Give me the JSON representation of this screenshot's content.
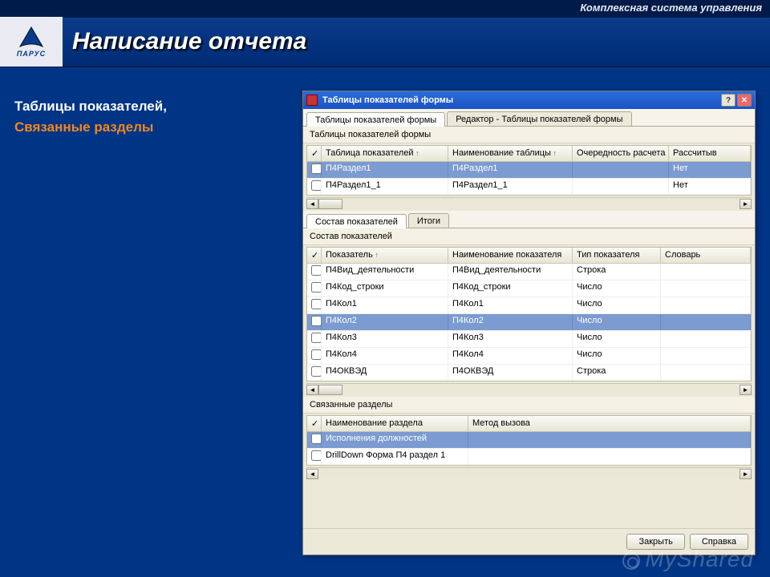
{
  "topbar": {
    "title": "Комплексная система управления"
  },
  "logo": {
    "brand": "ПАРУС"
  },
  "page": {
    "title": "Написание отчета"
  },
  "side": {
    "line1": "Таблицы показателей,",
    "line2": "Связанные разделы"
  },
  "watermark": "MyShared",
  "dialog": {
    "title": "Таблицы показателей формы",
    "tabs_main": [
      "Таблицы показателей формы",
      "Редактор - Таблицы показателей формы"
    ],
    "active_main_tab": 0,
    "section1": {
      "title": "Таблицы показателей формы",
      "headers": [
        "",
        "Таблица показателей",
        "Наименование таблицы",
        "Очередность расчета",
        "Рассчитыв"
      ],
      "rows": [
        {
          "sel": true,
          "name": "П4Раздел1",
          "desc": "П4Раздел1",
          "calc": "",
          "flag": "Нет"
        },
        {
          "sel": false,
          "name": "П4Раздел1_1",
          "desc": "П4Раздел1_1",
          "calc": "",
          "flag": "Нет"
        }
      ]
    },
    "tabs_mid": [
      "Состав показателей",
      "Итоги"
    ],
    "active_mid_tab": 0,
    "section2": {
      "title": "Состав показателей",
      "headers": [
        "",
        "Показатель",
        "Наименование показателя",
        "Тип показателя",
        "Словарь"
      ],
      "rows": [
        {
          "sel": false,
          "name": "П4Вид_деятельности",
          "desc": "П4Вид_деятельности",
          "type": "Строка",
          "dict": ""
        },
        {
          "sel": false,
          "name": "П4Код_строки",
          "desc": "П4Код_строки",
          "type": "Число",
          "dict": ""
        },
        {
          "sel": false,
          "name": "П4Кол1",
          "desc": "П4Кол1",
          "type": "Число",
          "dict": ""
        },
        {
          "sel": true,
          "name": "П4Кол2",
          "desc": "П4Кол2",
          "type": "Число",
          "dict": ""
        },
        {
          "sel": false,
          "name": "П4Кол3",
          "desc": "П4Кол3",
          "type": "Число",
          "dict": ""
        },
        {
          "sel": false,
          "name": "П4Кол4",
          "desc": "П4Кол4",
          "type": "Число",
          "dict": ""
        },
        {
          "sel": false,
          "name": "П4ОКВЭД",
          "desc": "П4ОКВЭД",
          "type": "Строка",
          "dict": ""
        }
      ]
    },
    "section3": {
      "title": "Связанные разделы",
      "headers": [
        "",
        "Наименование раздела",
        "Метод вызова"
      ],
      "rows": [
        {
          "sel": true,
          "name": "Исполнения должностей",
          "method": ""
        },
        {
          "sel": false,
          "name": "DrillDown Форма П4 раздел 1",
          "method": ""
        }
      ]
    },
    "buttons": {
      "close": "Закрыть",
      "help": "Справка"
    }
  }
}
